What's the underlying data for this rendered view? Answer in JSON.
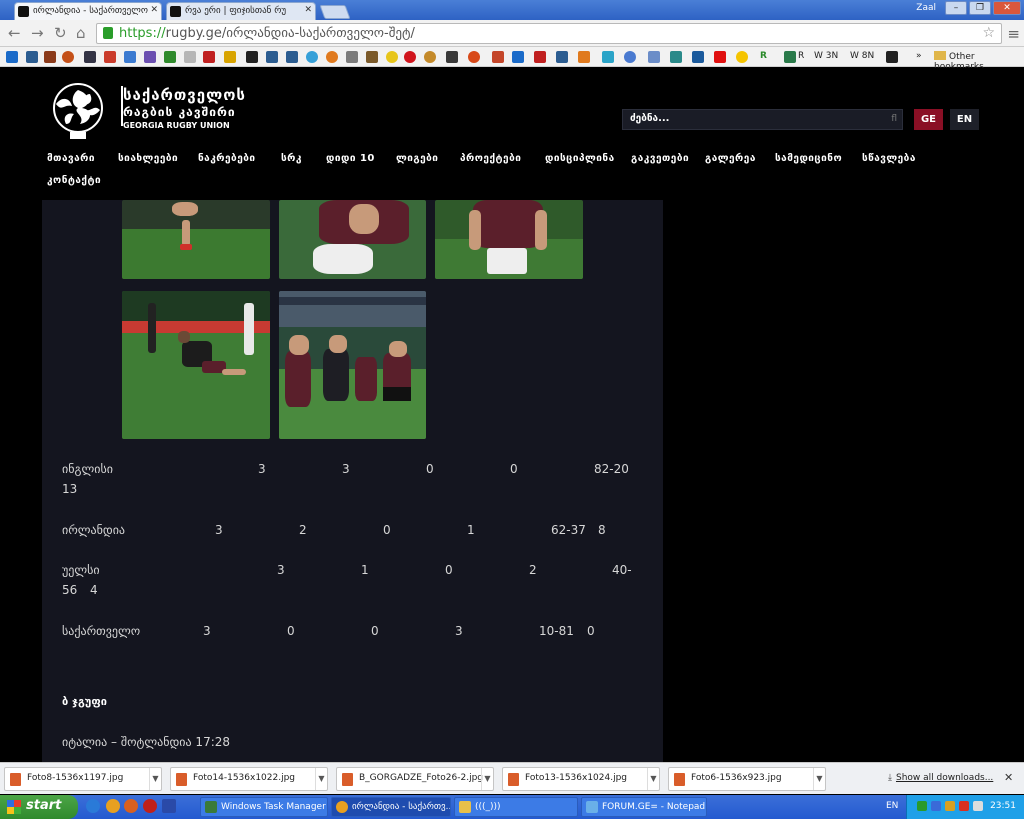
{
  "browser": {
    "tabs": [
      {
        "title": "ირლანდია - საქართველო"
      },
      {
        "title": "რვა ერი | ფიჯისთან რუ"
      }
    ],
    "user": "Zaal",
    "url": {
      "scheme": "https://",
      "host": "rugby.ge",
      "path": "/ირლანდია-საქართველო-შეტ/"
    }
  },
  "bookmarks": {
    "items": [
      {
        "label": "R"
      },
      {
        "label": "W 3N"
      },
      {
        "label": "W 8N"
      }
    ],
    "more": "»",
    "other": "Other bookmarks"
  },
  "site": {
    "logo": {
      "line1": "საქართველოს",
      "line2": "რაგბის კავშირი",
      "line3": "GEORGIA RUGBY UNION"
    },
    "search_placeholder": "ძებნა...",
    "lang_ge": "GE",
    "lang_en": "EN",
    "nav": [
      "მთავარი",
      "სიახლეები",
      "ნაკრებები",
      "სრკ",
      "დიდი 10",
      "ლიგები",
      "პროექტები",
      "დისციპლინა",
      "გაკვეთები",
      "გალერეა",
      "სამედიცინო",
      "სწავლება",
      "კონტაქტი"
    ]
  },
  "standings": [
    {
      "team": "ინგლისი",
      "cols": [
        "3",
        "3",
        "0",
        "0",
        "82-20",
        "13"
      ]
    },
    {
      "team": "ირლანდია",
      "cols": [
        "3",
        "2",
        "0",
        "1",
        "62-37",
        "8"
      ]
    },
    {
      "team": "უელსი",
      "cols": [
        "3",
        "1",
        "0",
        "2",
        "40-",
        "56",
        "4"
      ]
    },
    {
      "team": "საქართველო",
      "cols": [
        "3",
        "0",
        "0",
        "3",
        "10-81",
        "0"
      ]
    }
  ],
  "group_b": {
    "heading": "ბ ჯგუფი",
    "match": "იტალია – შოტლანდია 17:28"
  },
  "downloads": {
    "files": [
      "Foto8-1536x1197.jpg",
      "Foto14-1536x1022.jpg",
      "B_GORGADZE_Foto26-2.jpg",
      "Foto13-1536x1024.jpg",
      "Foto6-1536x923.jpg"
    ],
    "show_all": "Show all downloads..."
  },
  "taskbar": {
    "start": "start",
    "tasks": [
      "Windows Task Manager",
      "ირლანდია - საქართვ...",
      "(((_)))",
      "FORUM.GE= - Notepad"
    ],
    "lang": "EN",
    "clock": "23:51"
  }
}
